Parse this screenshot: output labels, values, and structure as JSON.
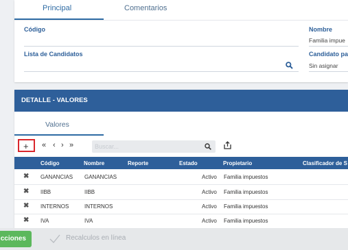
{
  "top_tabs": [
    {
      "label": "Principal"
    },
    {
      "label": "Comentarios"
    }
  ],
  "fields": {
    "codigo_label": "Código",
    "nombre_label": "Nombre",
    "nombre_value": "Familia impue",
    "lista_label": "Lista de Candidatos",
    "candidato_label": "Candidato pa",
    "candidato_value": "Sin asignar"
  },
  "detail": {
    "title": "DETALLE - VALORES",
    "tab": "Valores",
    "search_placeholder": "Buscar...",
    "columns": [
      "Código",
      "Nombre",
      "Reporte",
      "Estado",
      "Propietario",
      "Clasificador de S"
    ],
    "rows": [
      {
        "codigo": "GANANCIAS",
        "nombre": "GANANCIAS",
        "reporte": "",
        "estado": "Activo",
        "propietario": "Familia impuestos"
      },
      {
        "codigo": "IIBB",
        "nombre": "IIBB",
        "reporte": "",
        "estado": "Activo",
        "propietario": "Familia impuestos"
      },
      {
        "codigo": "INTERNOS",
        "nombre": "INTERNOS",
        "reporte": "",
        "estado": "Activo",
        "propietario": "Familia impuestos"
      },
      {
        "codigo": "IVA",
        "nombre": "IVA",
        "reporte": "",
        "estado": "Activo",
        "propietario": "Familia impuestos"
      }
    ]
  },
  "toolbar": {
    "add_icon": "+",
    "first_icon": "«",
    "prev_icon": "‹",
    "next_icon": "›",
    "last_icon": "»",
    "search_icon": "search-icon",
    "export_icon": "export-icon",
    "delete_icon": "✖"
  },
  "bottom": {
    "actions_label": "cciones",
    "recalc_label": "Recalculos en línea"
  },
  "colors": {
    "header_blue": "#2e5f9a",
    "accent_blue": "#2d6aa3",
    "green": "#5cb85c",
    "highlight_red": "#d9262c"
  }
}
